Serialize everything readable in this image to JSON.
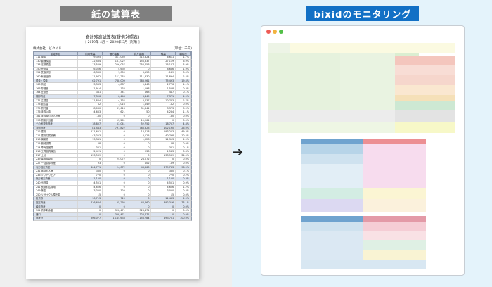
{
  "headers": {
    "left": "紙の試算表",
    "right": "bixidのモニタリング"
  },
  "document": {
    "title": "合計残高試算表(貸借対照表)",
    "period": "[ 2019年 4月 ～ 2020年 3月 (決算) ]",
    "company": "株式会社　ビクイド",
    "unit": "(単位：千円)",
    "columns": [
      "勘定科目",
      "前月残高",
      "借方金額",
      "貸方金額",
      "残高",
      "構成比"
    ],
    "rows": [
      {
        "section": false,
        "cells": [
          "111 現金",
          "9,395",
          "317,050",
          "315,324",
          "6,611",
          "1.7%"
        ]
      },
      {
        "section": false,
        "cells": [
          "130 普通預金",
          "22,434",
          "161,022",
          "156,337",
          "27,119",
          "6.9%"
        ]
      },
      {
        "section": false,
        "cells": [
          "138 定期預金",
          "13,569",
          "256,057",
          "258,456",
          "15,167",
          "3.9%"
        ]
      },
      {
        "section": false,
        "cells": [
          "150 売掛金",
          "6,056",
          "4,630",
          "0",
          "8,686",
          "1.9%"
        ]
      },
      {
        "section": false,
        "cells": [
          "151 受取手形",
          "6,360",
          "1,000",
          "6,150",
          "-149",
          "0.0%"
        ]
      },
      {
        "section": false,
        "cells": [
          "160 有価証券",
          "11,972",
          "111,252",
          "111,330",
          "11,894",
          "2.4%"
        ]
      },
      {
        "section": true,
        "cells": [
          "現金・預金",
          "62,791",
          "788,009",
          "783,261",
          "75,493",
          "19.4%"
        ]
      },
      {
        "section": false,
        "cells": [
          "163 商品",
          "3,363",
          "4,887",
          "5,443",
          "2,776",
          "1.1%"
        ]
      },
      {
        "section": false,
        "cells": [
          "166 貯蔵品",
          "1,914",
          "133",
          "1,198",
          "1,528",
          "0.3%"
        ]
      },
      {
        "section": false,
        "cells": [
          "164 仕掛品",
          "341",
          "341",
          "168",
          "447",
          "0.1%"
        ]
      },
      {
        "section": true,
        "cells": [
          "棚卸資産",
          "7,396",
          "6,444",
          "6,449",
          "7,371",
          "1.9%"
        ]
      },
      {
        "section": false,
        "cells": [
          "171 立替金",
          "11,884",
          "4,334",
          "4,437",
          "10,783",
          "2.7%"
        ]
      },
      {
        "section": false,
        "cells": [
          "173 仮払金",
          "62",
          "1,016",
          "1,149",
          "-62",
          "0.0%"
        ]
      },
      {
        "section": false,
        "cells": [
          "175 貸付金",
          "8,030",
          "31,613",
          "31,341",
          "3,373",
          "0.9%"
        ]
      },
      {
        "section": false,
        "cells": [
          "176 未収入金",
          "4,663",
          "621",
          "50",
          "4,234",
          "1.1%"
        ]
      },
      {
        "section": false,
        "cells": [
          "181 未収還付法人税等",
          "-30",
          "0",
          "0",
          "-30",
          "0.0%"
        ]
      },
      {
        "section": false,
        "cells": [
          "198 貸倒引当金",
          "0",
          "15,261",
          "15,261",
          "0",
          "0.0%"
        ]
      },
      {
        "section": true,
        "cells": [
          "その他流動資産",
          "18,807",
          "53,041",
          "52,752",
          "18,757",
          "4.8%"
        ]
      },
      {
        "section": true,
        "cells": [
          "流動資産",
          "81,443",
          "791,822",
          "786,323",
          "102,190",
          "26.0%"
        ]
      },
      {
        "section": false,
        "cells": [
          "212 建物",
          "211,621",
          "0",
          "18,418",
          "193,203",
          "49.3%"
        ]
      },
      {
        "section": false,
        "cells": [
          "211 建物付属設備",
          "43,323",
          "0",
          "3,125",
          "40,798",
          "10.4%"
        ]
      },
      {
        "section": false,
        "cells": [
          "213 構築物",
          "13,341",
          "0",
          "1,028",
          "11,313",
          "2.9%"
        ]
      },
      {
        "section": false,
        "cells": [
          "215 機械装置",
          "68",
          "0",
          "0",
          "68",
          "0.0%"
        ]
      },
      {
        "section": false,
        "cells": [
          "214 車両運搬具",
          "361",
          "0",
          "0",
          "361",
          "0.1%"
        ]
      },
      {
        "section": false,
        "cells": [
          "216 工具器具備品",
          "2,421",
          "0",
          "933",
          "1,543",
          "0.3%"
        ]
      },
      {
        "section": false,
        "cells": [
          "217 土地",
          "133,539",
          "0",
          "0",
          "133,539",
          "34.0%"
        ]
      },
      {
        "section": false,
        "cells": [
          "239 建設仮勘定",
          "0",
          "24,072",
          "24,072",
          "0",
          "0.0%"
        ]
      },
      {
        "section": false,
        "cells": [
          "227 一括償却資産",
          "93",
          "0",
          "102",
          "-89",
          "0.0%"
        ]
      },
      {
        "section": true,
        "cells": [
          "有形固定資産",
          "404,771",
          "24,072",
          "48,660",
          "379,733",
          "96.9%"
        ]
      },
      {
        "section": false,
        "cells": [
          "231 電話加入権",
          "380",
          "0",
          "0",
          "380",
          "0.1%"
        ]
      },
      {
        "section": false,
        "cells": [
          "236 ソフトウェア",
          "770",
          "0",
          "0",
          "770",
          "0.2%"
        ]
      },
      {
        "section": true,
        "cells": [
          "無形固定資産",
          "1,150",
          "0",
          "0",
          "1,150",
          "0.3%"
        ]
      },
      {
        "section": false,
        "cells": [
          "240 出資金",
          "4,551",
          "0",
          "0",
          "4,551",
          "0.9%"
        ]
      },
      {
        "section": false,
        "cells": [
          "241 長期前払費用",
          "4,656",
          "0",
          "0",
          "4,656",
          "1.2%"
        ]
      },
      {
        "section": false,
        "cells": [
          "249 敷金",
          "3,300",
          "720",
          "0",
          "3,020",
          "0.8%"
        ]
      },
      {
        "section": false,
        "cells": [
          "250 リサイクル預託金",
          "15",
          "0",
          "0",
          "15",
          "0.0%"
        ]
      },
      {
        "section": true,
        "cells": [
          "投資等",
          "10,713",
          "720",
          "0",
          "11,433",
          "2.9%"
        ]
      },
      {
        "section": true,
        "cells": [
          "固定資産",
          "416,634",
          "25,292",
          "48,660",
          "392,316",
          "73.1%"
        ]
      },
      {
        "section": true,
        "cells": [
          "繰延資産",
          "0",
          "0",
          "0",
          "0",
          "0.0%"
        ]
      },
      {
        "section": false,
        "cells": [
          "501 資本剰余金",
          "0",
          "328,471",
          "328,471",
          "0",
          "0.0%"
        ]
      },
      {
        "section": true,
        "cells": [
          "諸口",
          "0",
          "328,471",
          "328,471",
          "0",
          "0.0%"
        ]
      },
      {
        "section": true,
        "cells": [
          "資産計",
          "506,077",
          "1,145,633",
          "1,158,784",
          "493,751",
          "100.0%"
        ]
      }
    ]
  },
  "arrow": "➔",
  "colors": {
    "left_bg": "#efefef",
    "right_bg": "#e4f3fb",
    "left_header": "#7f7f7f",
    "right_header": "#1270c5"
  }
}
